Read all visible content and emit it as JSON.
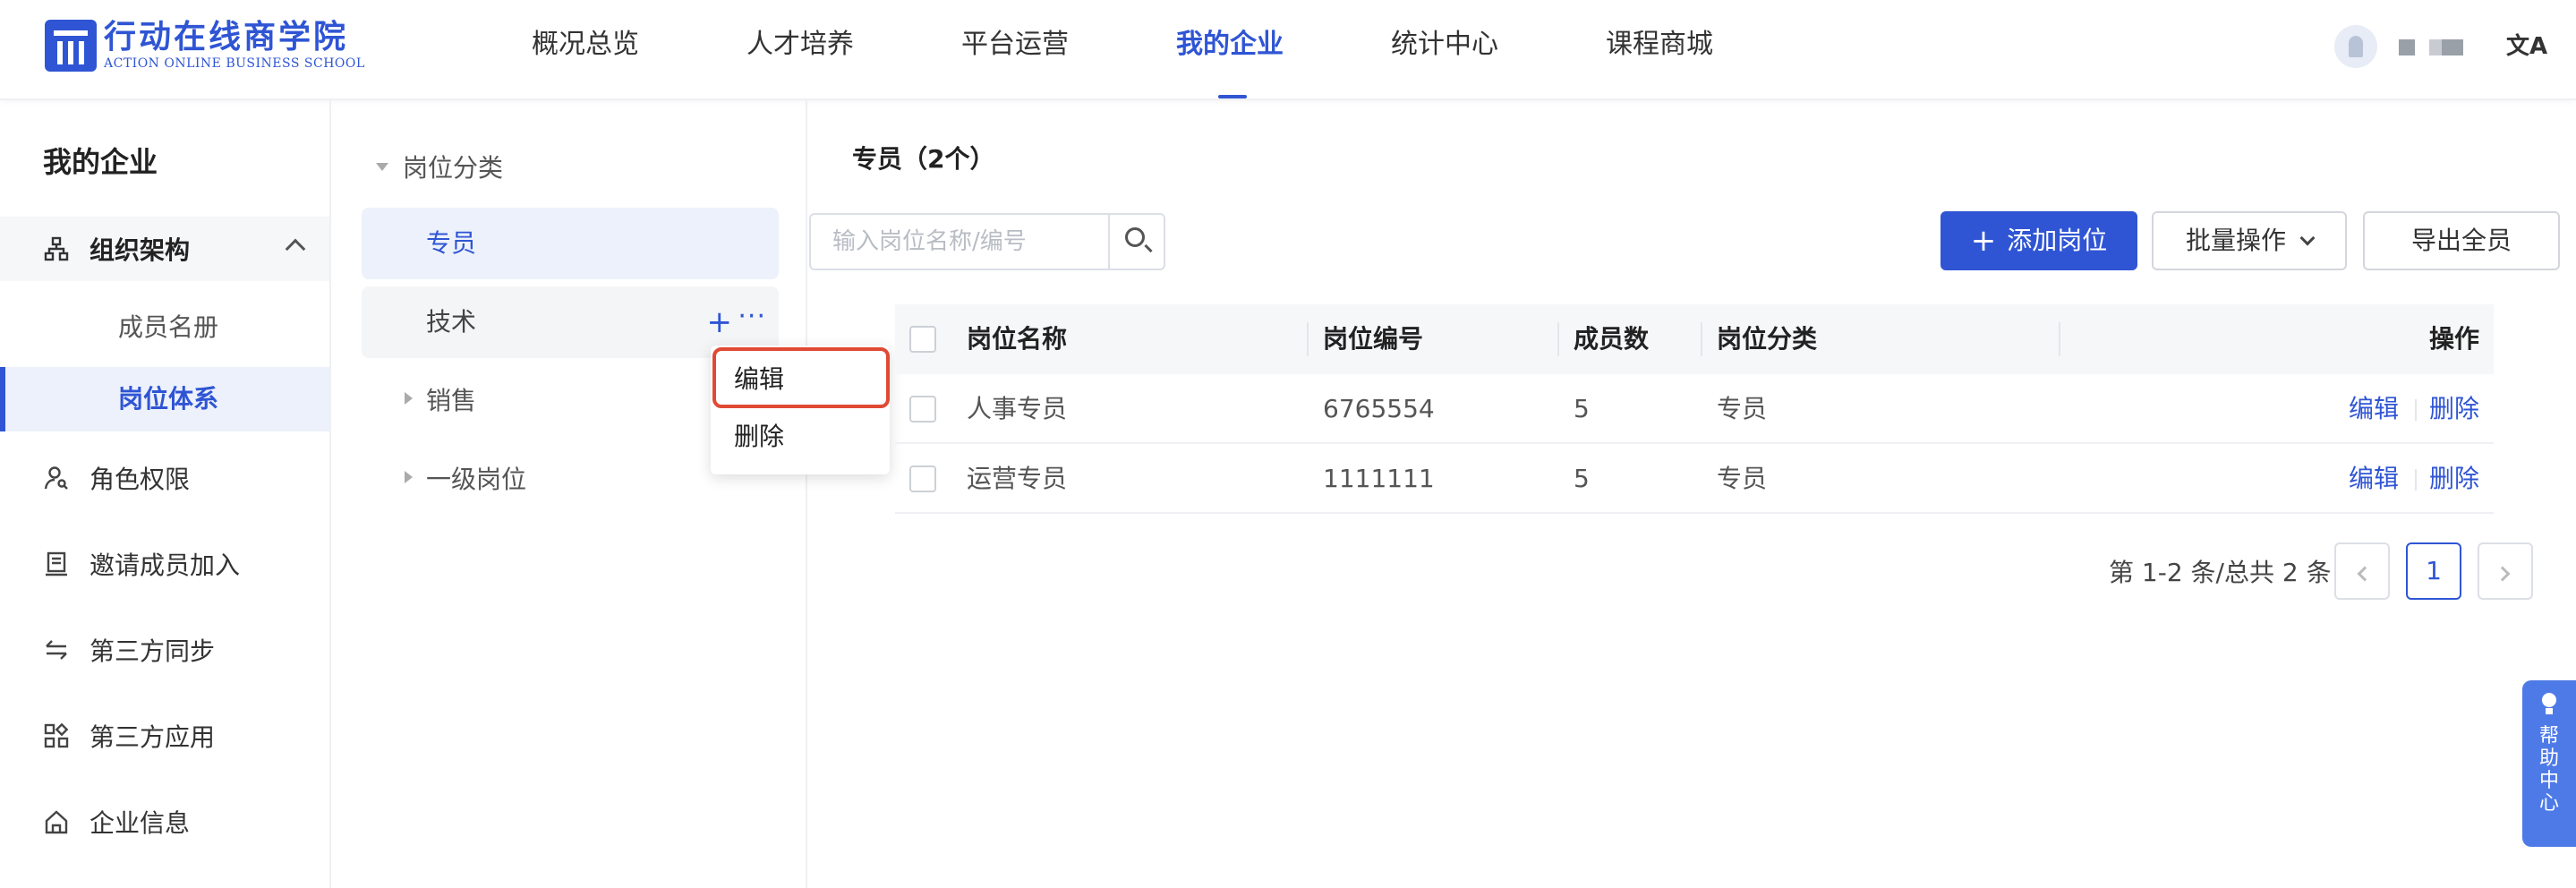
{
  "app": {
    "logo_cn": "行动在线商学院",
    "logo_en": "ACTION ONLINE BUSINESS SCHOOL",
    "brand_color": "#2f55d4"
  },
  "header": {
    "nav": [
      "概况总览",
      "人才培养",
      "平台运营",
      "我的企业",
      "统计中心",
      "课程商城"
    ],
    "active_nav": "我的企业",
    "lang_icon": "文A"
  },
  "sidebar": {
    "title": "我的企业",
    "group": "组织架构",
    "sub_items": [
      "成员名册",
      "岗位体系"
    ],
    "active_sub": "岗位体系",
    "items": [
      "角色权限",
      "邀请成员加入",
      "第三方同步",
      "第三方应用",
      "企业信息"
    ]
  },
  "tree": {
    "root": "岗位分类",
    "nodes": [
      "专员",
      "技术",
      "销售",
      "一级岗位"
    ],
    "selected": "专员",
    "hovered": "技术",
    "plus": "+",
    "more": "···"
  },
  "context_menu": {
    "items": [
      "编辑",
      "删除"
    ],
    "highlight_color": "#e04a34"
  },
  "main": {
    "title": "专员（2个）",
    "search_placeholder": "输入岗位名称/编号",
    "add_button": "添加岗位",
    "batch_button": "批量操作",
    "export_button": "导出全员"
  },
  "table": {
    "columns": [
      "岗位名称",
      "岗位编号",
      "成员数",
      "岗位分类",
      "操作"
    ],
    "rows": [
      {
        "name": "人事专员",
        "code": "6765554",
        "count": "5",
        "category": "专员",
        "edit": "编辑",
        "delete": "删除"
      },
      {
        "name": "运营专员",
        "code": "1111111",
        "count": "5",
        "category": "专员",
        "edit": "编辑",
        "delete": "删除"
      }
    ]
  },
  "pagination": {
    "summary": "第 1-2 条/总共 2 条",
    "current_page": "1"
  },
  "help": {
    "label": "帮助中心"
  }
}
